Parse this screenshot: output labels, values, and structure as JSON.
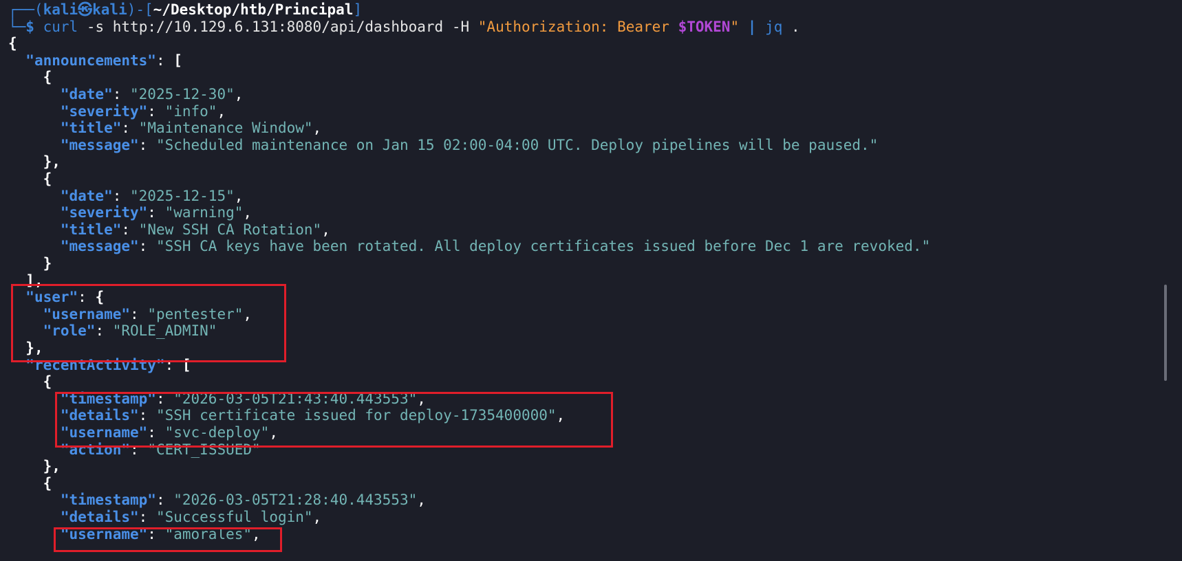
{
  "prompt": {
    "frame_top": "┌──(",
    "user_host": "kali㉿kali",
    "bracket_mid": ")-[",
    "cwd": "~/Desktop/htb/Principal",
    "bracket_end": "]",
    "frame_bottom": "└─",
    "dollar": "$"
  },
  "command": {
    "program": "curl",
    "args": " -s http://10.129.6.131:8080/api/dashboard -H ",
    "header_open": "\"Authorization: Bearer ",
    "header_var": "$TOKEN",
    "header_close": "\"",
    "pipe": "|",
    "jq": "jq",
    "jq_arg": " ."
  },
  "json": {
    "announcements_key": "\"announcements\"",
    "date_key": "\"date\"",
    "severity_key": "\"severity\"",
    "title_key": "\"title\"",
    "message_key": "\"message\"",
    "announcements": [
      {
        "date": "\"2025-12-30\"",
        "severity": "\"info\"",
        "title": "\"Maintenance Window\"",
        "message": "\"Scheduled maintenance on Jan 15 02:00-04:00 UTC. Deploy pipelines will be paused.\""
      },
      {
        "date": "\"2025-12-15\"",
        "severity": "\"warning\"",
        "title": "\"New SSH CA Rotation\"",
        "message": "\"SSH CA keys have been rotated. All deploy certificates issued before Dec 1 are revoked.\""
      }
    ],
    "user_key": "\"user\"",
    "username_key": "\"username\"",
    "role_key": "\"role\"",
    "user": {
      "username": "\"pentester\"",
      "role": "\"ROLE_ADMIN\""
    },
    "recent_key": "\"recentActivity\"",
    "timestamp_key": "\"timestamp\"",
    "details_key": "\"details\"",
    "action_key": "\"action\"",
    "recentActivity": [
      {
        "timestamp": "\"2026-03-05T21:43:40.443553\"",
        "details": "\"SSH certificate issued for deploy-1735400000\"",
        "username": "\"svc-deploy\"",
        "action": "\"CERT_ISSUED\""
      },
      {
        "timestamp": "\"2026-03-05T21:28:40.443553\"",
        "details": "\"Successful login\"",
        "username": "\"amorales\""
      }
    ]
  },
  "colors": {
    "background": "#1c1e28",
    "key": "#4a90e8",
    "string": "#73b5b5",
    "highlight": "#e01e2a"
  }
}
